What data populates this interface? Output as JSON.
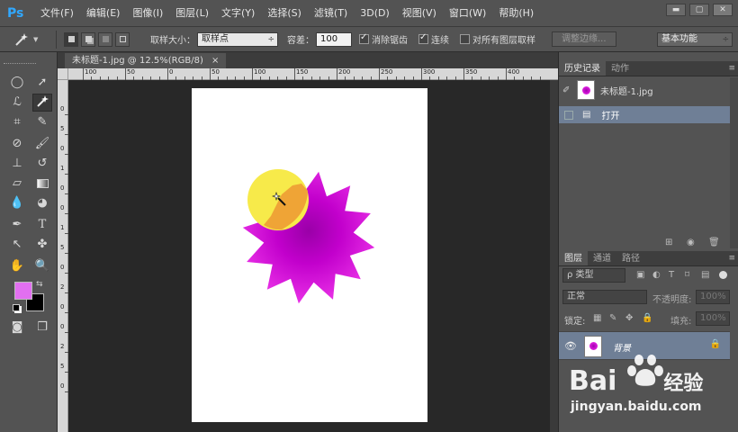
{
  "app": {
    "logo": "Ps",
    "menu": [
      "文件(F)",
      "编辑(E)",
      "图像(I)",
      "图层(L)",
      "文字(Y)",
      "选择(S)",
      "滤镜(T)",
      "3D(D)",
      "视图(V)",
      "窗口(W)",
      "帮助(H)"
    ],
    "window_controls": [
      "▬",
      "▢",
      "✕"
    ]
  },
  "options": {
    "sample_size_label": "取样大小：",
    "sample_size_value": "取样点",
    "tolerance_label": "容差：",
    "tolerance_value": "100",
    "antialias_label": "消除锯齿",
    "antialias_checked": true,
    "contiguous_label": "连续",
    "contiguous_checked": true,
    "sample_all_label": "对所有图层取样",
    "sample_all_checked": false,
    "refine_edge_label": "调整边缘...",
    "workspace_value": "基本功能"
  },
  "document": {
    "tab_title": "未标题-1.jpg @ 12.5%(RGB/8)",
    "tab_close": "×",
    "ruler_top_labels": [
      "100",
      "50",
      "0",
      "50",
      "100",
      "150",
      "200",
      "250",
      "300",
      "350",
      "400"
    ],
    "ruler_left_labels": [
      "0",
      "5",
      "0",
      "1",
      "0",
      "0",
      "1",
      "5",
      "0",
      "2",
      "0",
      "0",
      "2",
      "5",
      "0"
    ]
  },
  "history_panel": {
    "tabs": [
      "历史记录",
      "动作"
    ],
    "snapshot_name": "未标题-1.jpg",
    "states": [
      "打开"
    ]
  },
  "layers_panel": {
    "tabs": [
      "图层",
      "通道",
      "路径"
    ],
    "filter_kind": "ρ 类型",
    "blend_mode": "正常",
    "opacity_label": "不透明度:",
    "opacity_value": "100%",
    "lock_label": "锁定:",
    "fill_label": "填充:",
    "fill_value": "100%",
    "layers": [
      {
        "name": "背景"
      }
    ]
  },
  "watermark": {
    "brand": "Bai",
    "brand_end": "经验",
    "url": "jingyan.baidu.com"
  },
  "colors": {
    "foreground": "#e26ff0",
    "background": "#000000",
    "flower": "#d400dc",
    "circle": "#f5e03c"
  }
}
